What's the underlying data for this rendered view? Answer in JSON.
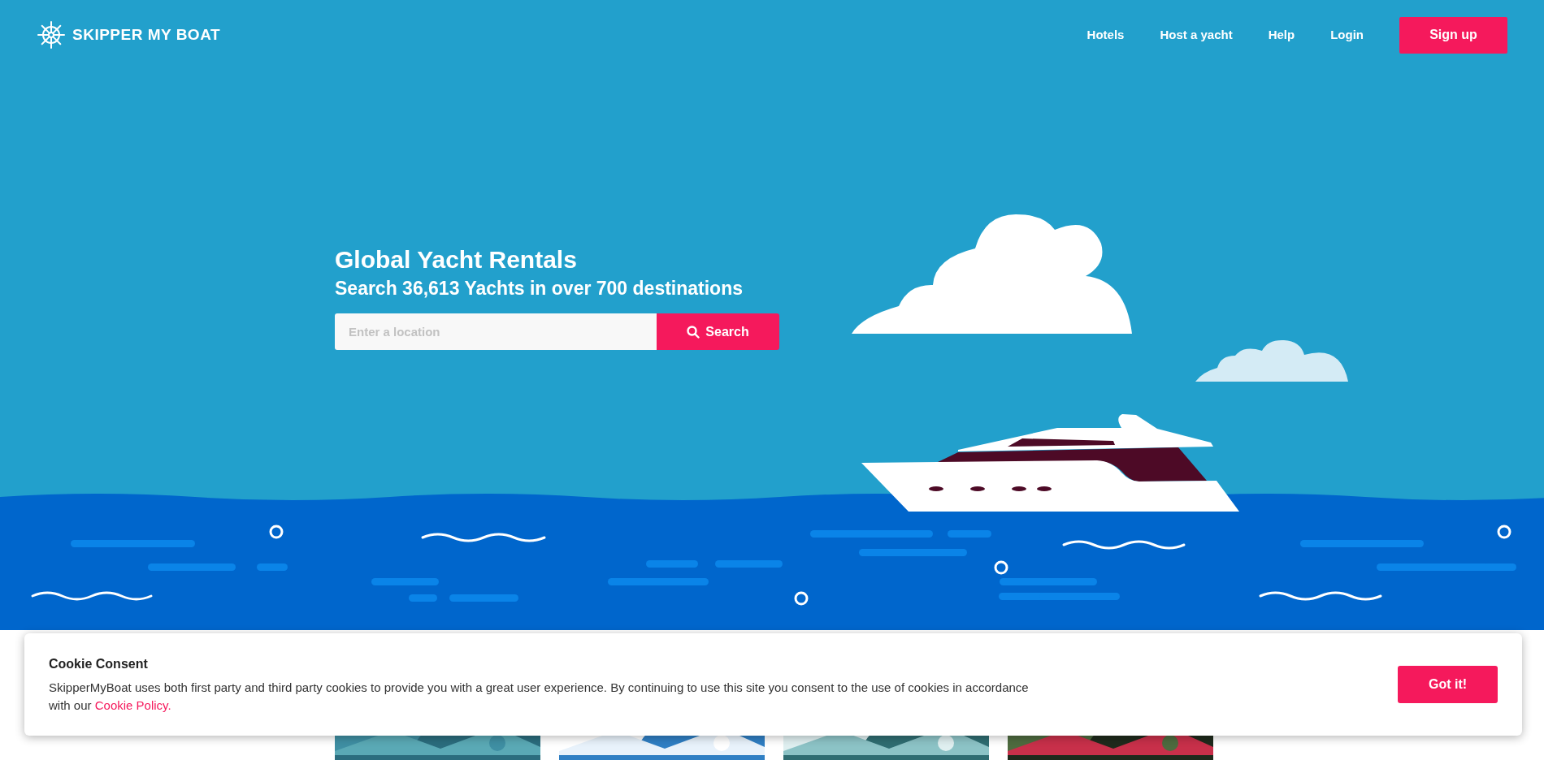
{
  "header": {
    "logo": "SKIPPER MY BOAT",
    "nav": [
      "Hotels",
      "Host a yacht",
      "Help",
      "Login"
    ],
    "signup": "Sign up"
  },
  "hero": {
    "title": "Global Yacht Rentals",
    "subtitle": "Search 36,613 Yachts in over 700 destinations",
    "search": {
      "placeholder": "Enter a location",
      "button": "Search"
    }
  },
  "cookie_banner": {
    "title": "Cookie Consent",
    "text": "SkipperMyBoat uses both first party and third party cookies to provide you with a great user experience. By continuing to use this site you consent to the use of cookies in accordance with our",
    "link": "Cookie Policy.",
    "button": "Got it!"
  }
}
